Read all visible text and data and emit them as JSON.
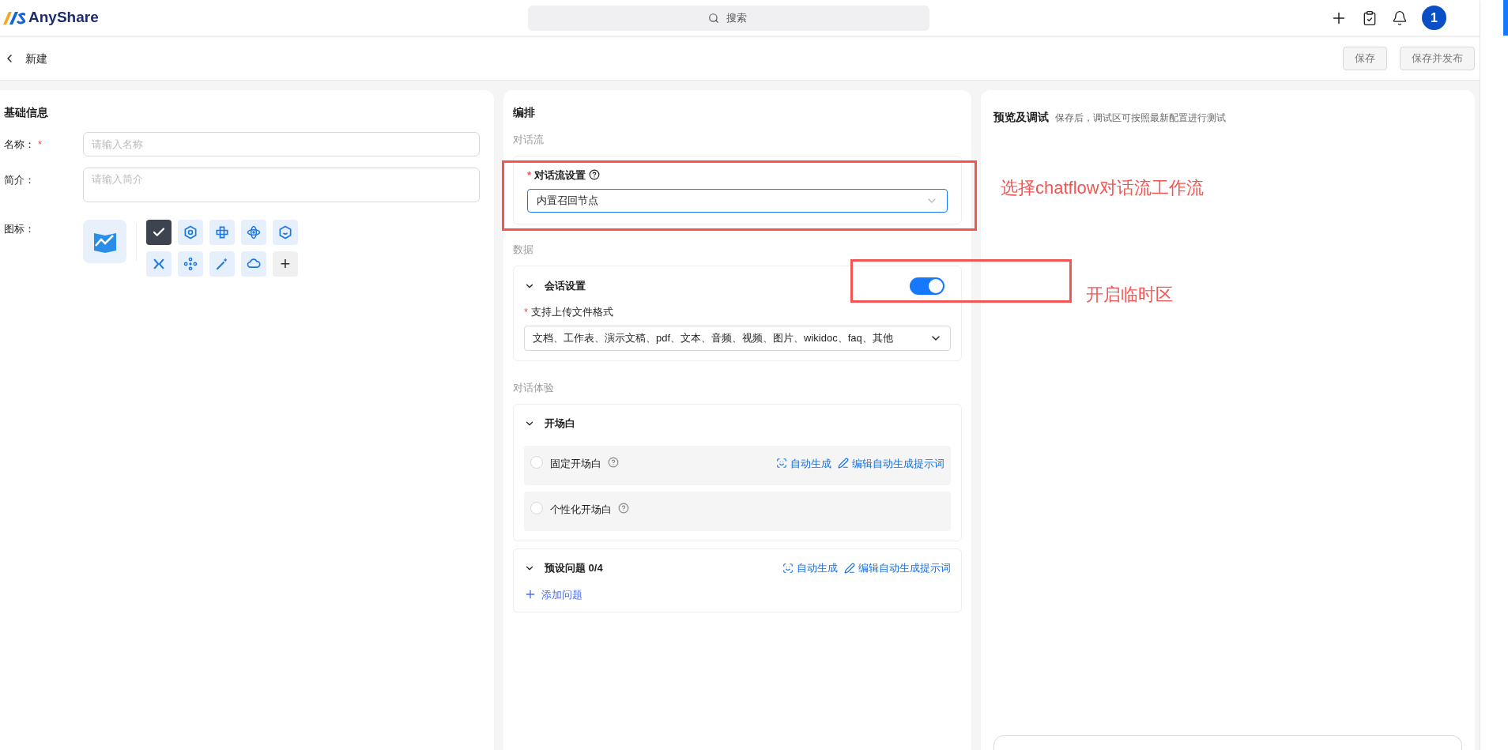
{
  "header": {
    "logo": "AnyShare",
    "search": {
      "placeholder": "搜索"
    },
    "avatar": "1"
  },
  "subheader": {
    "title": "新建",
    "buttons": [
      "保存",
      "保存并发布"
    ]
  },
  "basic_info": {
    "title": "基础信息",
    "fields": [
      {
        "label": "名称：",
        "required_mark": "*",
        "placeholder": "请输入名称",
        "kind": "input"
      },
      {
        "label": "简介：",
        "placeholder": "请输入简介",
        "kind": "textarea"
      }
    ],
    "icon_label": "图标：",
    "icons": [
      {
        "selected": true
      },
      {
        "selected": false
      },
      {
        "selected": false
      },
      {
        "selected": false
      },
      {
        "selected": false
      },
      {
        "selected": false
      },
      {
        "selected": false
      },
      {
        "selected": false
      },
      {
        "selected": false
      }
    ],
    "add_icon": "+"
  },
  "orchestration": {
    "title": "编排",
    "chatflow": {
      "section": "对话流",
      "label": "对话流设置",
      "required_mark": "*",
      "value": "内置召回节点"
    },
    "data": {
      "section": "数据",
      "title": "会话设置",
      "expanded": true,
      "on": true,
      "label": "支持上传文件格式",
      "required_mark": "*",
      "value": "文档、工作表、演示文稿、pdf、文本、音频、视频、图片、wikidoc、faq、其他"
    },
    "experience": {
      "section": "对话体验",
      "opening": {
        "title": "开场白",
        "expanded": true,
        "options": [
          {
            "label": "固定开场白",
            "selected": false,
            "actions": [
              "自动生成",
              "编辑自动生成提示词"
            ]
          },
          {
            "label": "个性化开场白",
            "selected": false
          }
        ]
      },
      "preset": {
        "title": "预设问题 0/4",
        "expanded": true,
        "actions": [
          "自动生成",
          "编辑自动生成提示词"
        ],
        "add": "添加问题"
      }
    }
  },
  "preview": {
    "title": "预览及调试",
    "hint": "保存后，调试区可按照最新配置进行测试"
  },
  "annotations": [
    "选择chatflow对话流工作流",
    "开启临时区"
  ]
}
